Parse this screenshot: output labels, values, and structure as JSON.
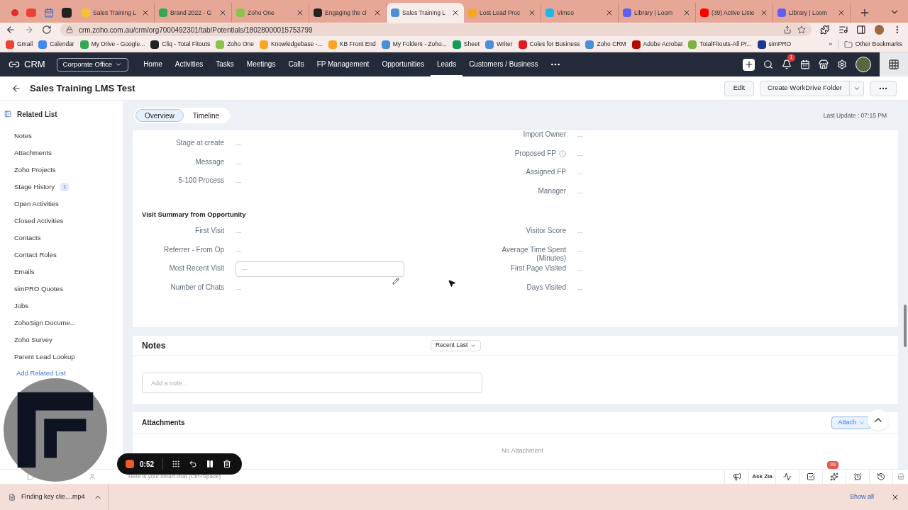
{
  "browser": {
    "tabs": [
      {
        "title": "Sales Training L",
        "selected": false,
        "color": "#f4c430"
      },
      {
        "title": "Brand 2022 - G",
        "selected": false,
        "color": "#34a853"
      },
      {
        "title": "Zoho One",
        "selected": false,
        "color": "#8bc34a"
      },
      {
        "title": "Engaging the cl",
        "selected": false,
        "color": "#222222"
      },
      {
        "title": "Sales Training L",
        "selected": true,
        "color": "#4a90d9"
      },
      {
        "title": "Lost Lead Proc",
        "selected": false,
        "color": "#f5a623"
      },
      {
        "title": "Vimeo",
        "selected": false,
        "color": "#1ab7ea"
      },
      {
        "title": "Library | Loom",
        "selected": false,
        "color": "#625df5"
      },
      {
        "title": "(39) Active Liste",
        "selected": false,
        "color": "#ff0000"
      },
      {
        "title": "Library | Loom",
        "selected": false,
        "color": "#625df5"
      }
    ],
    "url": "crm.zoho.com.au/crm/org7000492301/tab/Potentials/18028000015753799",
    "bookmarks": [
      {
        "title": "Gmail",
        "color": "#ea4335"
      },
      {
        "title": "Calendar",
        "color": "#4285f4"
      },
      {
        "title": "My Drive - Google...",
        "color": "#34a853"
      },
      {
        "title": "Cliq - Total Fitouts",
        "color": "#222222"
      },
      {
        "title": "Zoho One",
        "color": "#8bc34a"
      },
      {
        "title": "Knowledgebase -...",
        "color": "#f5a623"
      },
      {
        "title": "KB Front End",
        "color": "#f5a623"
      },
      {
        "title": "My Folders - Zoho...",
        "color": "#4a90d9"
      },
      {
        "title": "Sheet",
        "color": "#0f9d58"
      },
      {
        "title": "Writer",
        "color": "#4a90d9"
      },
      {
        "title": "Coles for Business",
        "color": "#e01a22"
      },
      {
        "title": "Zoho CRM",
        "color": "#4a90d9"
      },
      {
        "title": "Adobe Acrobat",
        "color": "#b30b00"
      },
      {
        "title": "TotalFitouts-All Pr...",
        "color": "#7cb342"
      },
      {
        "title": "simPRO",
        "color": "#1a3a8f"
      }
    ],
    "more_bookmarks": "»",
    "other_bookmarks": "Other Bookmarks"
  },
  "crm_nav": {
    "brand": "CRM",
    "org": "Corporate Office",
    "items": [
      {
        "label": "Home",
        "selected": false
      },
      {
        "label": "Activities",
        "selected": false
      },
      {
        "label": "Tasks",
        "selected": false
      },
      {
        "label": "Meetings",
        "selected": false
      },
      {
        "label": "Calls",
        "selected": false
      },
      {
        "label": "FP Management",
        "selected": false
      },
      {
        "label": "Opportunities",
        "selected": false
      },
      {
        "label": "Leads",
        "selected": true
      },
      {
        "label": "Customers / Business",
        "selected": false
      }
    ],
    "notification_count": "1"
  },
  "record": {
    "title": "Sales Training LMS Test",
    "buttons": [
      "Edit",
      "Create WorkDrive Folder"
    ]
  },
  "sidebar": {
    "heading": "Related List",
    "items": [
      {
        "label": "Notes"
      },
      {
        "label": "Attachments"
      },
      {
        "label": "Zoho Projects"
      },
      {
        "label": "Stage History",
        "badge": "1"
      },
      {
        "label": "Open Activities"
      },
      {
        "label": "Closed Activities"
      },
      {
        "label": "Contacts"
      },
      {
        "label": "Contact Roles"
      },
      {
        "label": "Emails"
      },
      {
        "label": "simPRO Quotes"
      },
      {
        "label": "Jobs"
      },
      {
        "label": "ZohoSign Docume..."
      },
      {
        "label": "Zoho Survey"
      },
      {
        "label": "Parent Lead Lookup"
      }
    ],
    "add_link": "Add Related List"
  },
  "view_tabs": [
    {
      "label": "Overview",
      "selected": true
    },
    {
      "label": "Timeline",
      "selected": false
    }
  ],
  "last_update": "Last Update : 07:15 PM",
  "details": {
    "left_fields": [
      {
        "label": "Stage at create",
        "value": "—",
        "kind": "text"
      },
      {
        "label": "Message",
        "value": "—",
        "kind": "text"
      },
      {
        "label": "5-100 Process",
        "value": "—",
        "kind": "text"
      }
    ],
    "right_fields": [
      {
        "label": "Import Owner",
        "value": "—",
        "kind": "text"
      },
      {
        "label": "Proposed FP",
        "value": "—",
        "kind": "info"
      },
      {
        "label": "Assigned FP",
        "value": "—",
        "kind": "text"
      },
      {
        "label": "Manager",
        "value": "—",
        "kind": "text"
      }
    ],
    "section_title": "Visit Summary from Opportunity",
    "section_left": [
      {
        "label": "First Visit",
        "value": "—",
        "kind": "text"
      },
      {
        "label": "Referrer - From Op",
        "value": "—",
        "kind": "text"
      },
      {
        "label": "Most Recent Visit",
        "value": "—",
        "kind": "input"
      },
      {
        "label": "Number of Chats",
        "value": "—",
        "kind": "text"
      }
    ],
    "section_right": [
      {
        "label": "Visitor Score",
        "value": "—",
        "kind": "text"
      },
      {
        "label": "Average Time Spent (Minutes)",
        "value": "—",
        "kind": "text"
      },
      {
        "label": "First Page Visited",
        "value": "—",
        "kind": "text"
      },
      {
        "label": "Days Visited",
        "value": "—",
        "kind": "text"
      }
    ]
  },
  "notes": {
    "title": "Notes",
    "sort": "Recent Last",
    "placeholder": "Add a note..."
  },
  "attachments": {
    "title": "Attachments",
    "button": "Attach",
    "empty": "No Attachment"
  },
  "recorder": {
    "time": "0:52"
  },
  "footer": {
    "chat_placeholder": "Here is your smart chat (Ctrl+Space)",
    "ask_zia": "Ask Zia",
    "badge": "39"
  },
  "downloads": {
    "file": "Finding key clie....mp4",
    "show_all": "Show all"
  }
}
